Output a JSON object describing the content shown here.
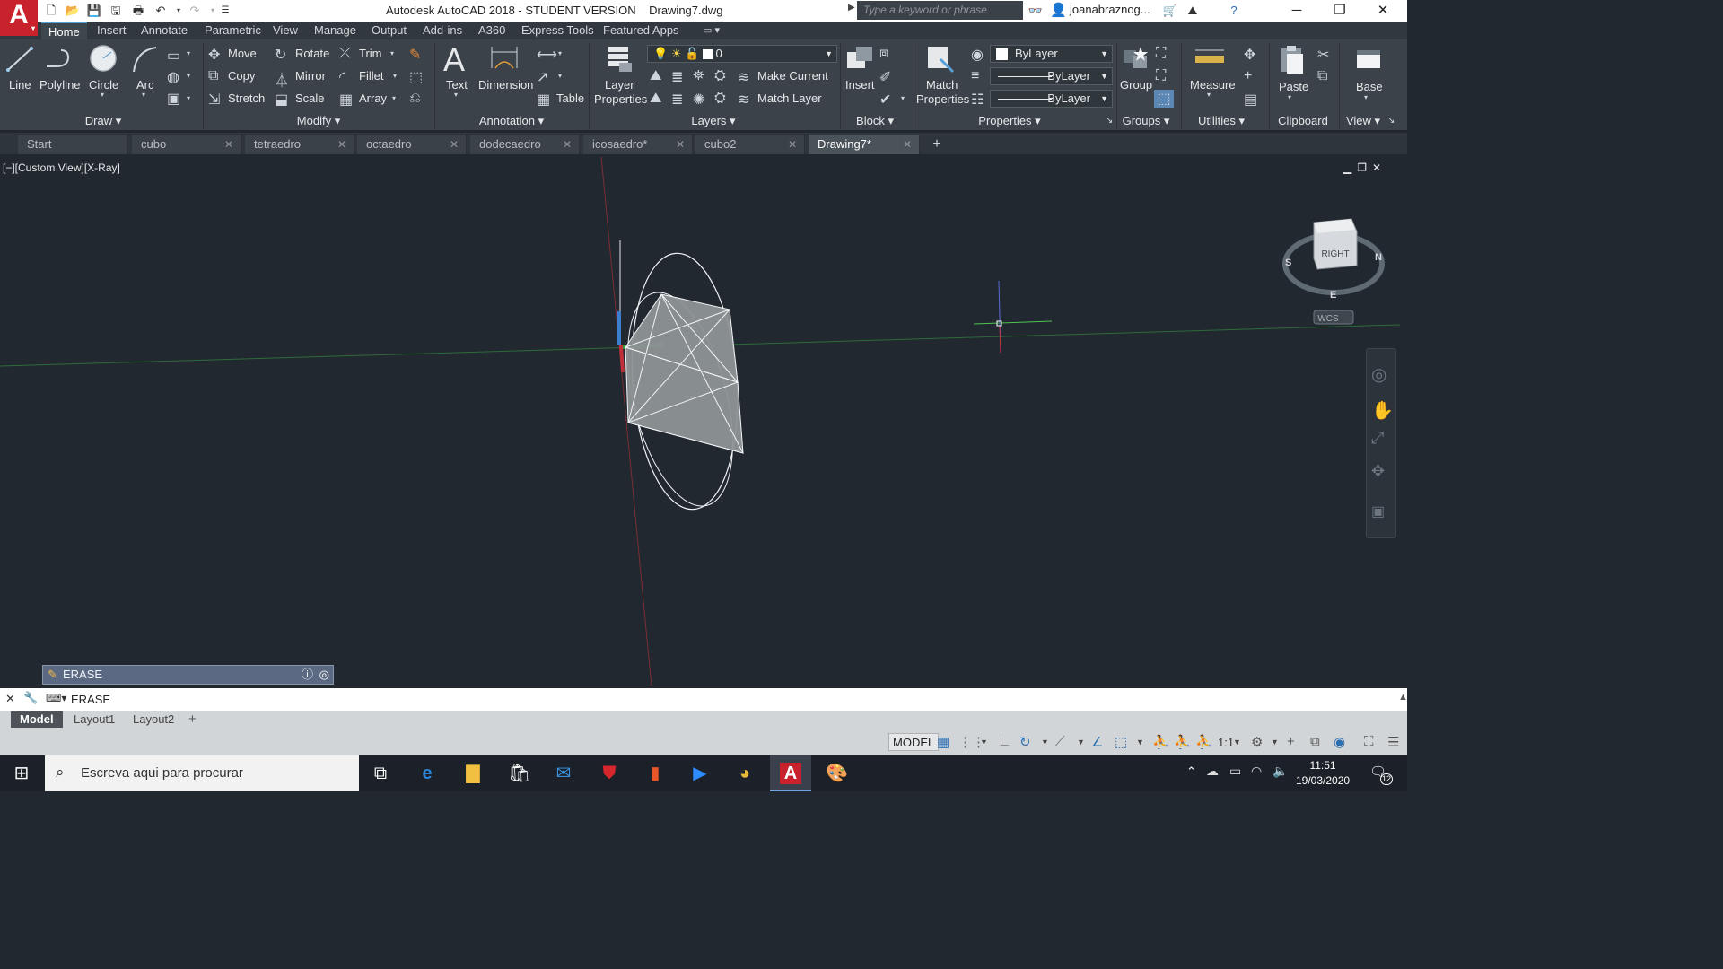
{
  "titlebar": {
    "app_title": "Autodesk AutoCAD 2018 - STUDENT VERSION    Drawing7.dwg",
    "search_placeholder": "Type a keyword or phrase",
    "user": "joanabraznog..."
  },
  "ribbon_tabs": [
    "Home",
    "Insert",
    "Annotate",
    "Parametric",
    "View",
    "Manage",
    "Output",
    "Add-ins",
    "A360",
    "Express Tools",
    "Featured Apps"
  ],
  "draw": {
    "line": "Line",
    "polyline": "Polyline",
    "circle": "Circle",
    "arc": "Arc",
    "title": "Draw"
  },
  "modify": {
    "move": "Move",
    "rotate": "Rotate",
    "trim": "Trim",
    "copy": "Copy",
    "mirror": "Mirror",
    "fillet": "Fillet",
    "stretch": "Stretch",
    "scale": "Scale",
    "array": "Array",
    "title": "Modify"
  },
  "annotation": {
    "text": "Text",
    "dimension": "Dimension",
    "table": "Table",
    "title": "Annotation"
  },
  "layers": {
    "layer_properties_1": "Layer",
    "layer_properties_2": "Properties",
    "current_layer": "0",
    "make_current": "Make Current",
    "match_layer": "Match Layer",
    "title": "Layers"
  },
  "block": {
    "insert": "Insert",
    "title": "Block"
  },
  "properties": {
    "match_1": "Match",
    "match_2": "Properties",
    "color": "ByLayer",
    "linetype": "ByLayer",
    "lineweight": "ByLayer",
    "title": "Properties"
  },
  "groups": {
    "group": "Group",
    "title": "Groups"
  },
  "utilities": {
    "measure": "Measure",
    "title": "Utilities"
  },
  "clipboard": {
    "paste": "Paste",
    "title": "Clipboard"
  },
  "view_panel": {
    "base": "Base",
    "title": "View"
  },
  "file_tabs": [
    "Start",
    "cubo",
    "tetraedro",
    "octaedro",
    "dodecaedro",
    "icosaedro*",
    "cubo2",
    "Drawing7*"
  ],
  "viewport": {
    "label": "[−][Custom View][X-Ray]",
    "viewcube_face": "RIGHT",
    "compass_s": "S",
    "compass_n": "N",
    "compass_e": "E",
    "wcs": "WCS"
  },
  "command": {
    "panel_text": "ERASE",
    "line_text": "ERASE"
  },
  "layout_tabs": [
    "Model",
    "Layout1",
    "Layout2"
  ],
  "status": {
    "model": "MODEL",
    "scale": "1:1"
  },
  "taskbar": {
    "search": "Escreva aqui para procurar",
    "time": "11:51",
    "date": "19/03/2020",
    "notifications": "12"
  },
  "colors": {
    "accent": "#50a5d8",
    "autocad_red": "#c8232c",
    "viewport_bg": "#212830",
    "ribbon_bg": "#3b4249"
  }
}
